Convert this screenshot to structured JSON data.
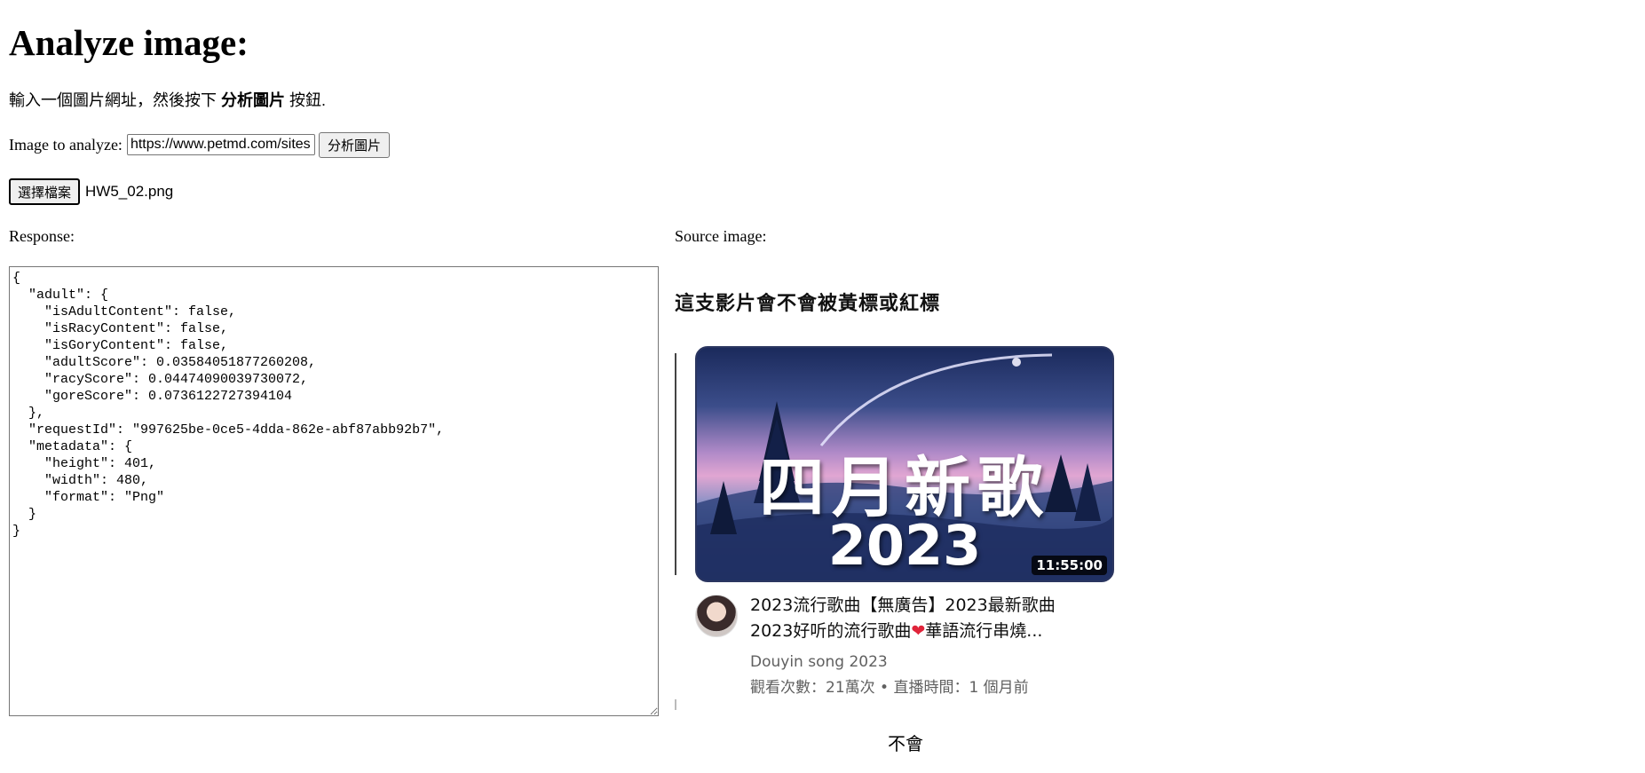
{
  "page": {
    "title": "Analyze image:",
    "intro_prefix": "輸入一個圖片網址，然後按下 ",
    "intro_bold": "分析圖片",
    "intro_suffix": " 按鈕."
  },
  "form": {
    "url_label": "Image to analyze:",
    "url_value": "https://www.petmd.com/sites",
    "analyze_button": "分析圖片",
    "file_button": "選擇檔案",
    "file_name": "HW5_02.png"
  },
  "response": {
    "label": "Response:",
    "json_text": "{\n  \"adult\": {\n    \"isAdultContent\": false,\n    \"isRacyContent\": false,\n    \"isGoryContent\": false,\n    \"adultScore\": 0.03584051877260208,\n    \"racyScore\": 0.04474090039730072,\n    \"goreScore\": 0.0736122727394104\n  },\n  \"requestId\": \"997625be-0ce5-4dda-862e-abf87abb92b7\",\n  \"metadata\": {\n    \"height\": 401,\n    \"width\": 480,\n    \"format\": \"Png\"\n  }\n}"
  },
  "source": {
    "label": "Source image:",
    "question": "這支影片會不會被黃標或紅標",
    "thumbnail_title": "四月新歌",
    "thumbnail_year": "2023",
    "duration": "11:55:00",
    "video_title_line1": "2023流行歌曲【無廣告】2023最新歌曲",
    "video_title_line2": "2023好听的流行歌曲",
    "video_title_line2_rest": "華語流行串燒...",
    "heart_icon": "heart-icon",
    "channel": "Douyin song 2023",
    "meta": "觀看次數：21萬次 • 直播時間：1 個月前",
    "verdict": "不會"
  }
}
